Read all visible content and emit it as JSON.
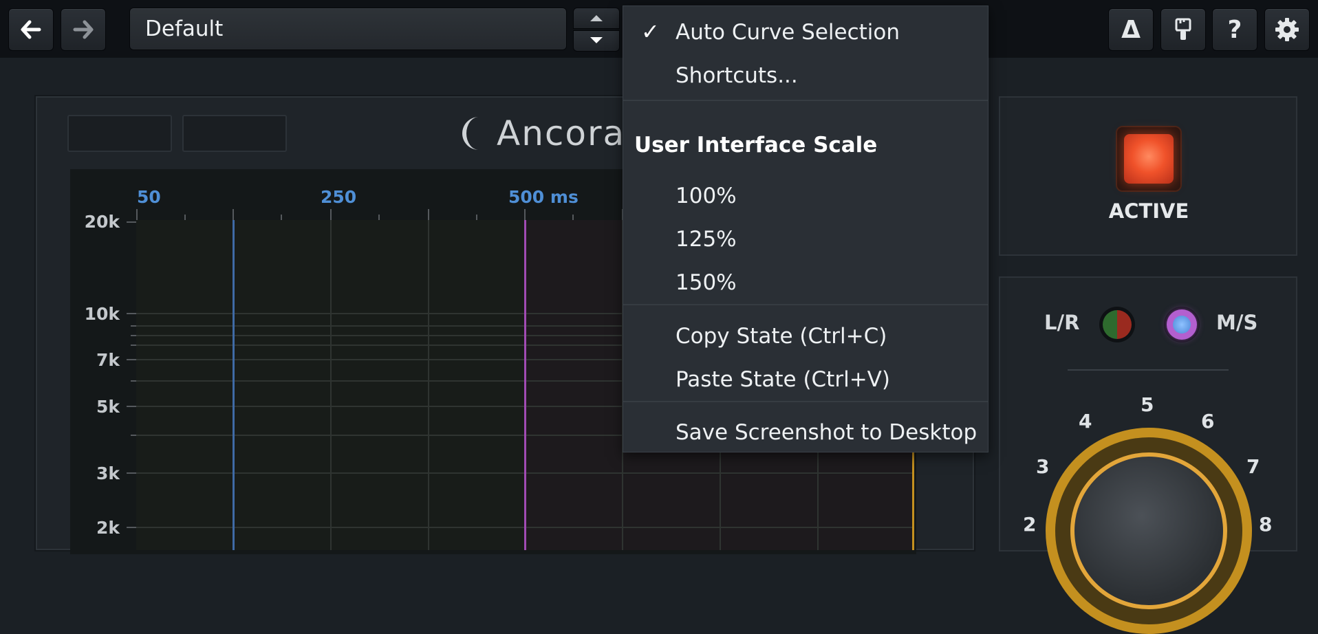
{
  "toolbar": {
    "back_icon": "arrow-left-icon",
    "forward_icon": "arrow-right-icon",
    "preset_name": "Default",
    "buttons": [
      "delta-icon",
      "paintbrush-icon",
      "help-icon",
      "gear-icon"
    ],
    "help_glyph": "?",
    "delta_glyph": "Δ"
  },
  "logo": {
    "text": "Ancora"
  },
  "graph": {
    "x_labels": [
      "50",
      "250",
      "500 ms"
    ],
    "y_labels": [
      "20k",
      "10k",
      "7k",
      "5k",
      "3k",
      "2k"
    ],
    "accent_colors": {
      "blue_marker": "#3f6aa5",
      "pink_marker": "#a14bb3",
      "orange_marker": "#c4901f",
      "x_label": "#4f8fd6"
    }
  },
  "right_panel": {
    "active_label": "ACTIVE",
    "lr_label": "L/R",
    "ms_label": "M/S",
    "knob_numbers": [
      "2",
      "3",
      "4",
      "5",
      "6",
      "7",
      "8"
    ]
  },
  "menu": {
    "check_glyph": "✓",
    "auto_curve": "Auto Curve Selection",
    "shortcuts": "Shortcuts...",
    "ui_scale_header": "User Interface Scale",
    "scale_100": "100%",
    "scale_125": "125%",
    "scale_150": "150%",
    "copy_state": "Copy State (Ctrl+C)",
    "paste_state": "Paste State (Ctrl+V)",
    "save_screenshot": "Save Screenshot to Desktop"
  }
}
